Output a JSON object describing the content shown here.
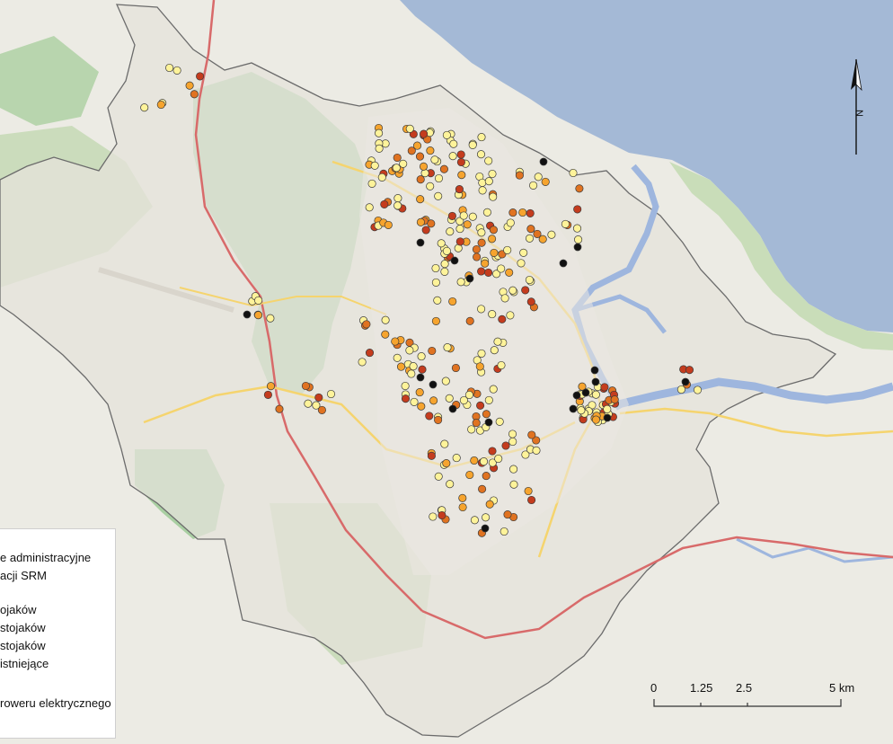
{
  "map": {
    "colors": {
      "sea": "#a4b9d6",
      "river": "#9eb6de",
      "forest": "#a9cfa2",
      "green": "#c9ddb9",
      "urban": "#e9e6de",
      "boundary": "#6b6b6b",
      "expressway": "#d86a6a",
      "main_road": "#f5d46e",
      "street": "#ffffff",
      "point_light": "#fef39a",
      "point_orange": "#f6a42e",
      "point_darkorange": "#e07321",
      "point_red": "#c43c1e",
      "point_black": "#111111"
    }
  },
  "legend": {
    "items": [
      "e administracyjne",
      "acji SRM",
      "ojaków",
      "stojaków",
      "stojaków",
      "istniejące",
      "roweru elektrycznego"
    ]
  },
  "north_arrow": {
    "label": "N"
  },
  "scalebar": {
    "labels": [
      "0",
      "1.25",
      "2.5",
      "5 km"
    ]
  }
}
